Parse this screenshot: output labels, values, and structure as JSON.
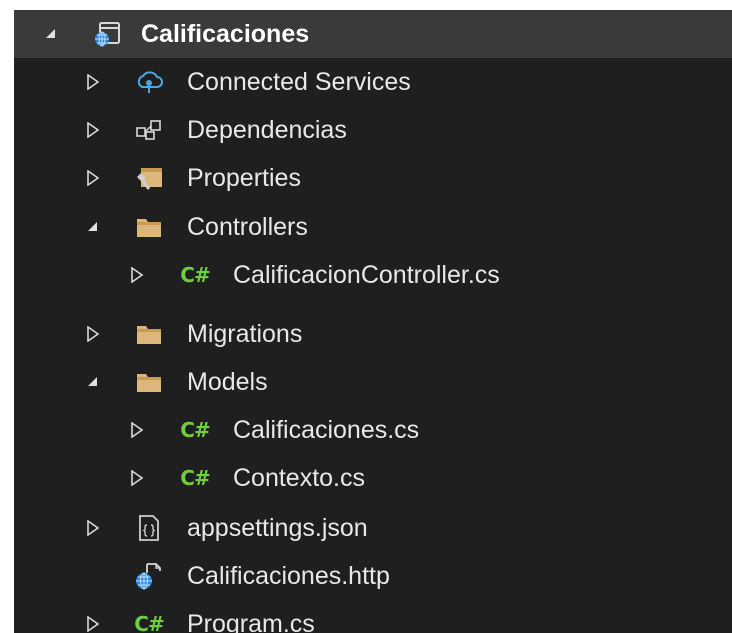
{
  "solution_explorer": {
    "project": {
      "label": "Calificaciones",
      "icon": "web-project-icon",
      "expanded": true,
      "selected": true
    },
    "items": [
      {
        "label": "Connected Services",
        "icon": "connected-services-icon",
        "expander": "collapsed"
      },
      {
        "label": "Dependencias",
        "icon": "dependencies-icon",
        "expander": "collapsed"
      },
      {
        "label": "Properties",
        "icon": "properties-folder-icon",
        "expander": "collapsed"
      },
      {
        "label": "Controllers",
        "icon": "folder-icon",
        "expander": "expanded"
      },
      {
        "label": "CalificacionController.cs",
        "icon": "csharp-file-icon",
        "icon_text": "C#",
        "expander": "collapsed"
      },
      {
        "label": "Migrations",
        "icon": "folder-icon",
        "expander": "collapsed"
      },
      {
        "label": "Models",
        "icon": "folder-icon",
        "expander": "expanded"
      },
      {
        "label": "Calificaciones.cs",
        "icon": "csharp-file-icon",
        "icon_text": "C#",
        "expander": "collapsed"
      },
      {
        "label": "Contexto.cs",
        "icon": "csharp-file-icon",
        "icon_text": "C#",
        "expander": "collapsed"
      },
      {
        "label": "appsettings.json",
        "icon": "json-file-icon",
        "expander": "collapsed"
      },
      {
        "label": "Calificaciones.http",
        "icon": "http-file-icon",
        "expander": "none"
      },
      {
        "label": "Program.cs",
        "icon": "csharp-file-icon",
        "icon_text": "C#",
        "expander": "collapsed"
      }
    ]
  },
  "colors": {
    "background": "#1f1f1f",
    "selected_row": "#3a3a3a",
    "text": "#e8e8e8",
    "folder": "#dcb67a",
    "csharp": "#6fcf3f",
    "service": "#4aa8e0"
  }
}
